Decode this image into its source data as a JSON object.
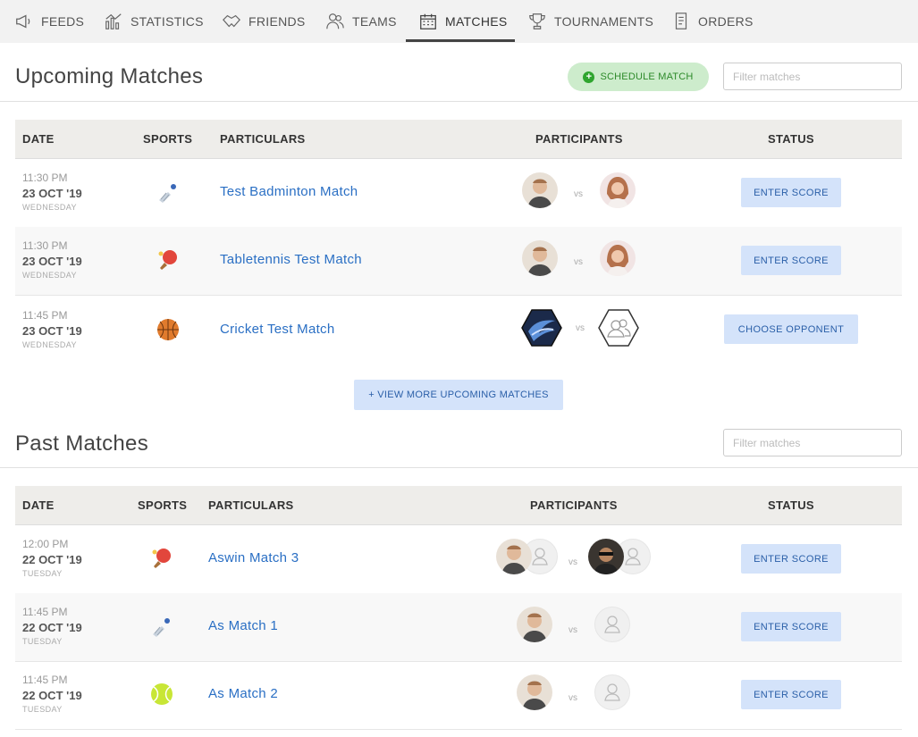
{
  "nav": {
    "items": [
      {
        "label": "FEEDS",
        "icon": "megaphone-icon"
      },
      {
        "label": "STATISTICS",
        "icon": "chart-icon"
      },
      {
        "label": "FRIENDS",
        "icon": "handshake-icon"
      },
      {
        "label": "TEAMS",
        "icon": "team-icon"
      },
      {
        "label": "MATCHES",
        "icon": "calendar-icon"
      },
      {
        "label": "TOURNAMENTS",
        "icon": "trophy-icon"
      },
      {
        "label": "ORDERS",
        "icon": "receipt-icon"
      }
    ],
    "active": "MATCHES"
  },
  "upcoming": {
    "title": "Upcoming Matches",
    "schedule_label": "SCHEDULE MATCH",
    "filter_placeholder": "Filter matches",
    "columns": [
      "DATE",
      "SPORTS",
      "PARTICULARS",
      "PARTICIPANTS",
      "STATUS"
    ],
    "vs": "vs",
    "rows": [
      {
        "time": "11:30 PM",
        "date": "23 OCT '19",
        "weekday": "WEDNESDAY",
        "sport": "badminton-icon",
        "title": "Test Badminton Match",
        "status": "ENTER SCORE"
      },
      {
        "time": "11:30 PM",
        "date": "23 OCT '19",
        "weekday": "WEDNESDAY",
        "sport": "table-tennis-icon",
        "title": "Tabletennis Test Match",
        "status": "ENTER SCORE"
      },
      {
        "time": "11:45 PM",
        "date": "23 OCT '19",
        "weekday": "WEDNESDAY",
        "sport": "basketball-icon",
        "title": "Cricket Test Match",
        "status": "CHOOSE OPPONENT"
      }
    ],
    "view_more": "+ VIEW MORE UPCOMING MATCHES"
  },
  "past": {
    "title": "Past Matches",
    "filter_placeholder": "Filter matches",
    "columns": [
      "DATE",
      "SPORTS",
      "PARTICULARS",
      "PARTICIPANTS",
      "STATUS"
    ],
    "vs": "vs",
    "rows": [
      {
        "time": "12:00 PM",
        "date": "22 OCT '19",
        "weekday": "TUESDAY",
        "sport": "table-tennis-icon",
        "title": "Aswin Match 3",
        "status": "ENTER SCORE"
      },
      {
        "time": "11:45 PM",
        "date": "22 OCT '19",
        "weekday": "TUESDAY",
        "sport": "badminton-icon",
        "title": "As Match 1",
        "status": "ENTER SCORE"
      },
      {
        "time": "11:45 PM",
        "date": "22 OCT '19",
        "weekday": "TUESDAY",
        "sport": "tennis-ball-icon",
        "title": "As Match 2",
        "status": "ENTER SCORE"
      }
    ]
  },
  "colors": {
    "link": "#2a6fc4",
    "button_bg": "#d4e3fa",
    "schedule_bg": "#cdeccc",
    "schedule_text": "#2d8a2a",
    "header_bg": "#eeedea",
    "nav_bg": "#f2f2f2"
  }
}
